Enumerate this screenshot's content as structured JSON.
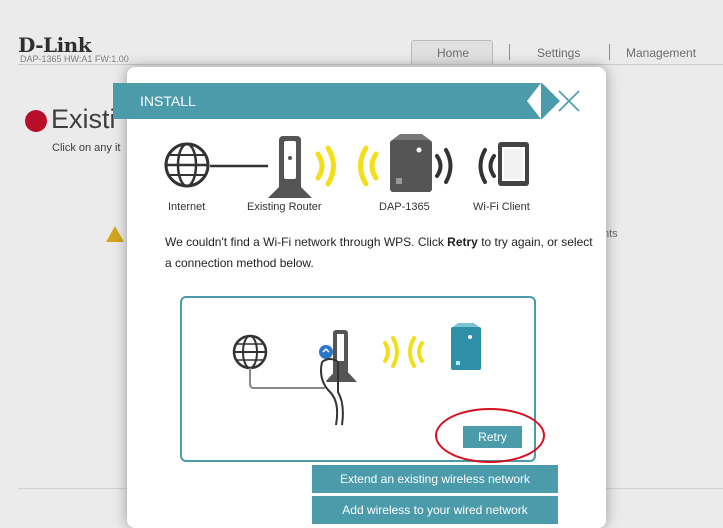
{
  "background": {
    "brand": "D-Link",
    "model_info": "DAP-1365   HW:A1   FW:1.00",
    "nav_tabs": [
      "Home",
      "Settings",
      "Management"
    ],
    "title": "Existi",
    "subtitle": "Click on any it",
    "right_text": "nts"
  },
  "modal": {
    "banner_label": "INSTALL",
    "topology_labels": [
      "Internet",
      "Existing Router",
      "DAP-1365",
      "Wi-Fi Client"
    ],
    "message_before": "We couldn't find a Wi-Fi network through WPS. Click ",
    "message_bold": "Retry",
    "message_after": " to try again, or select a connection method below.",
    "retry_label": "Retry",
    "method_buttons": [
      "Extend an existing wireless network",
      "Add wireless to your wired network"
    ]
  },
  "colors": {
    "accent": "#4b9bab",
    "highlight_circle": "#d6101e",
    "signal": "#f2df1a",
    "status_dot": "#c8102e"
  },
  "icons": [
    "globe-icon",
    "router-icon",
    "extender-icon",
    "tablet-icon",
    "wifi-signal-icon",
    "close-icon",
    "warning-icon",
    "wps-button-icon"
  ]
}
